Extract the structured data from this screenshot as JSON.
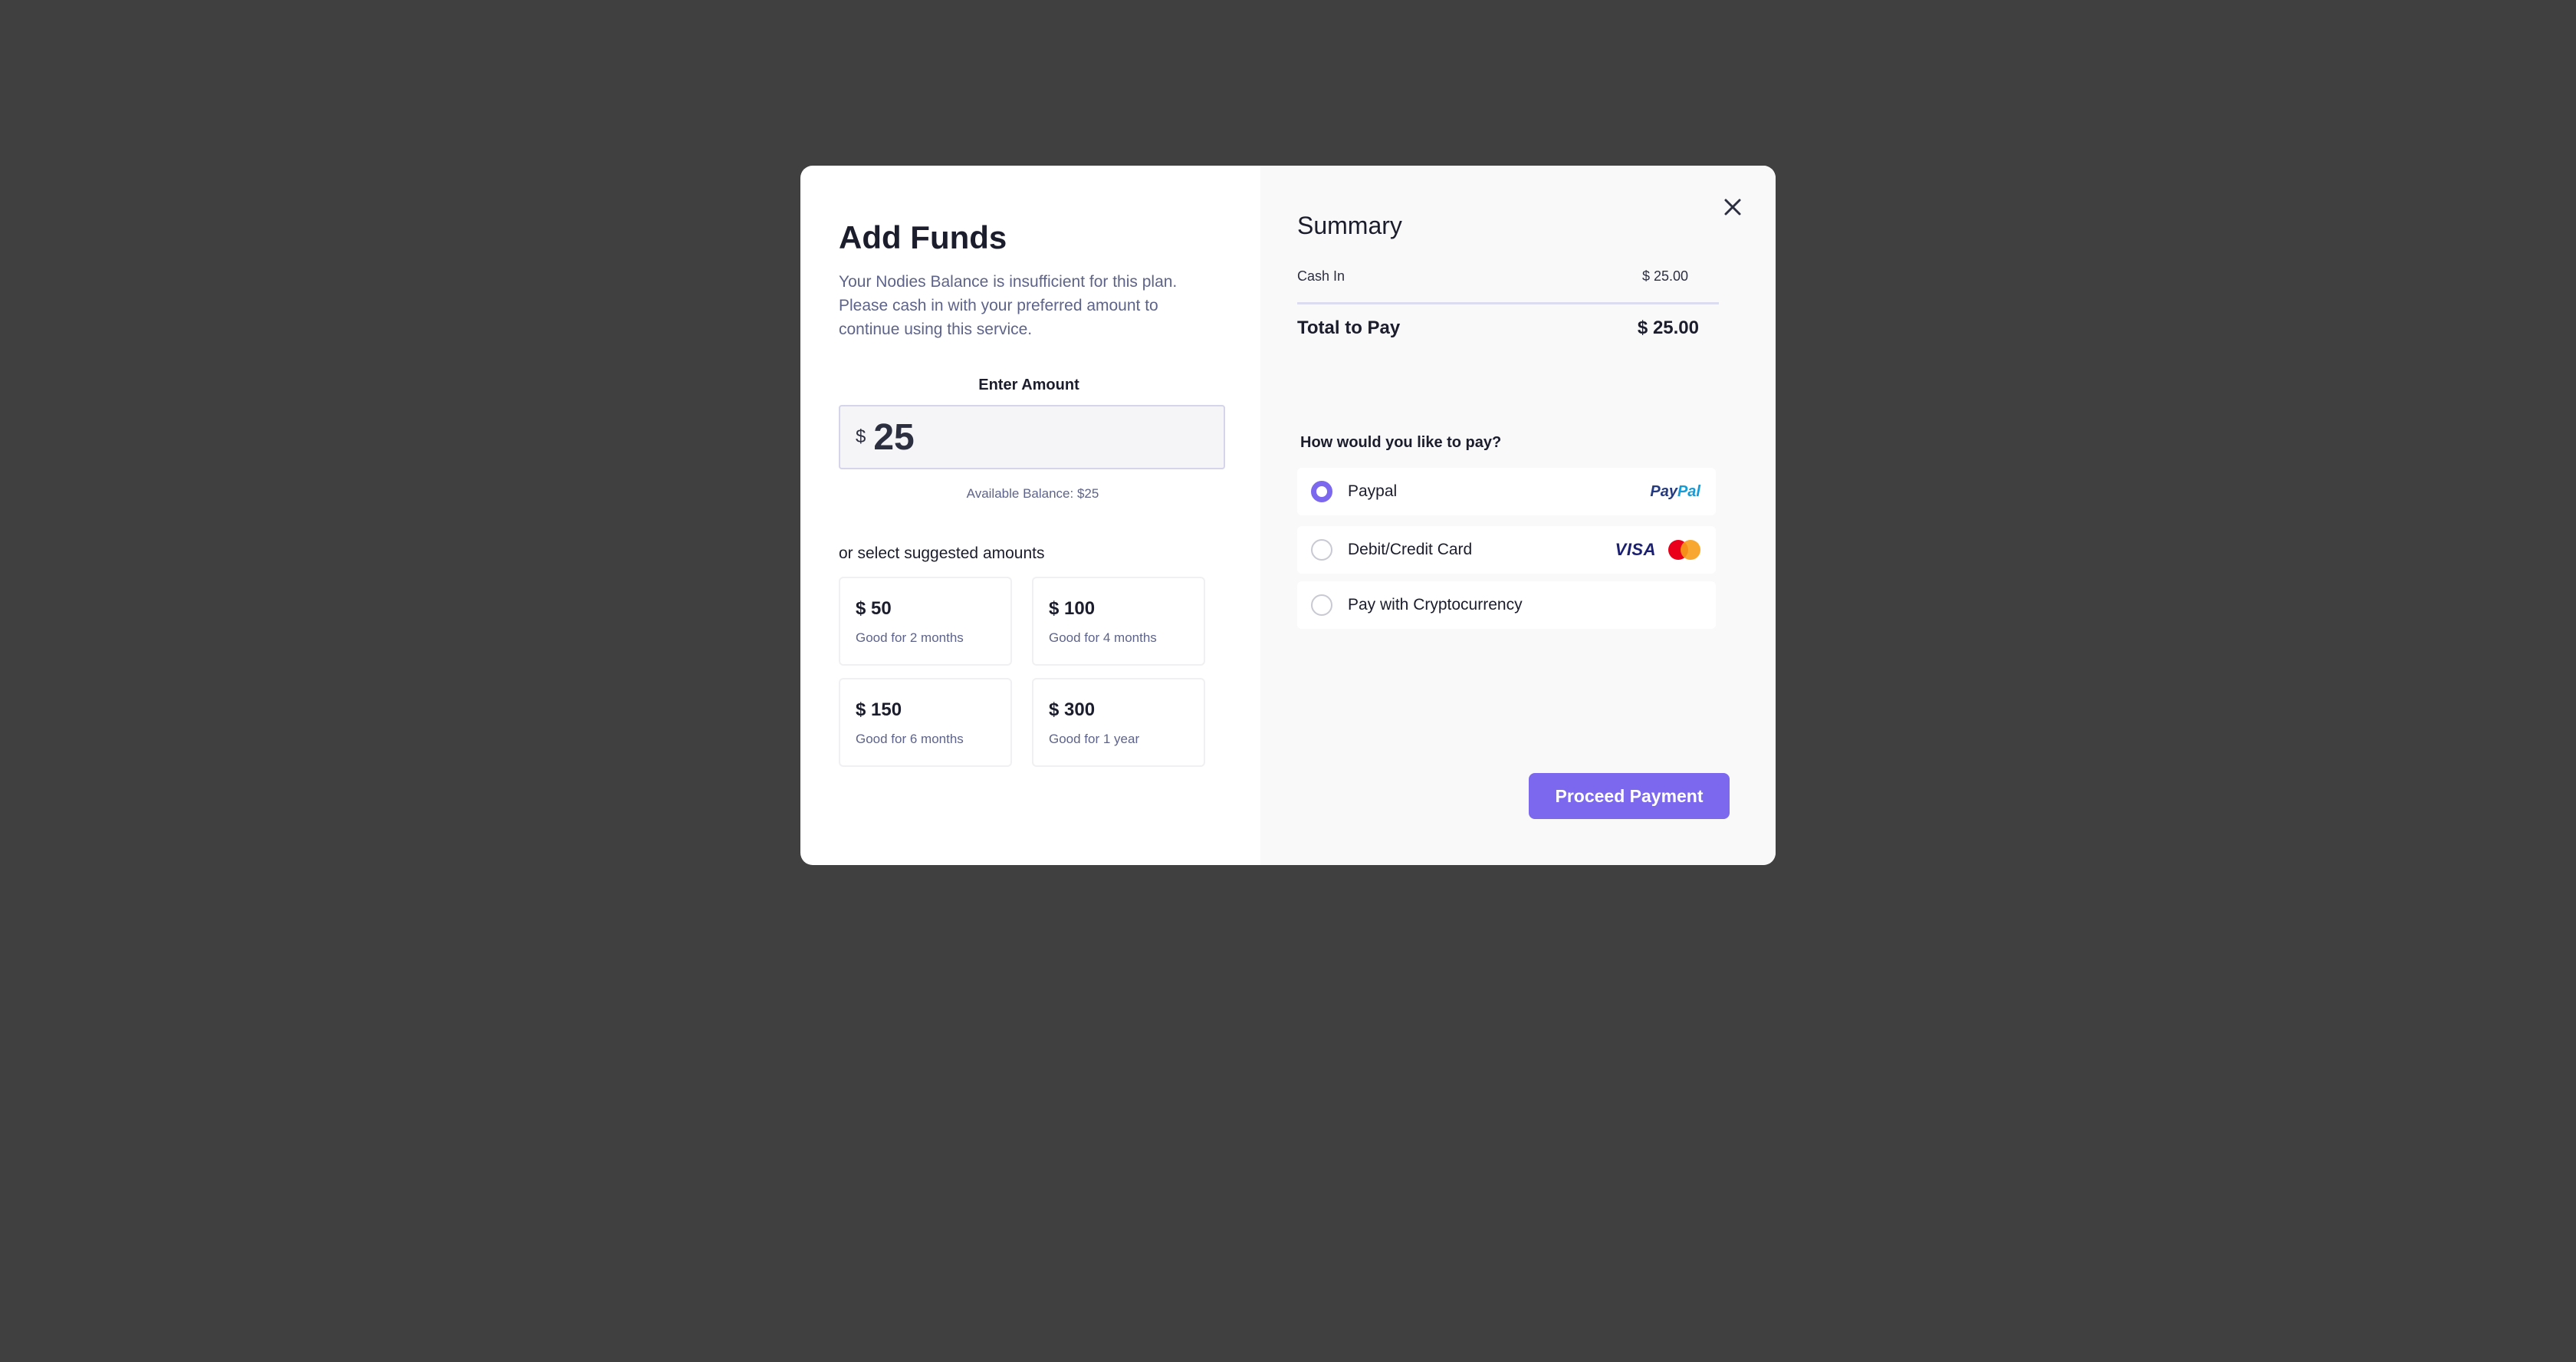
{
  "left": {
    "title": "Add Funds",
    "description": "Your Nodies Balance is insufficient for this plan. Please cash in with your preferred amount to continue using this service.",
    "enter_amount_label": "Enter Amount",
    "currency_symbol": "$",
    "amount_value": "25",
    "available_balance": "Available Balance: $25",
    "suggest_label": "or select suggested amounts",
    "suggestions": [
      {
        "amount": "$ 50",
        "note": "Good for 2 months"
      },
      {
        "amount": "$ 100",
        "note": "Good for 4 months"
      },
      {
        "amount": "$ 150",
        "note": "Good for 6 months"
      },
      {
        "amount": "$ 300",
        "note": "Good for 1 year"
      }
    ]
  },
  "right": {
    "close_icon": "close-icon",
    "summary_title": "Summary",
    "cash_in_label": "Cash In",
    "cash_in_value": "$ 25.00",
    "total_label": "Total to Pay",
    "total_value": "$ 25.00",
    "pay_question": "How would you like to pay?",
    "payment_options": [
      {
        "label": "Paypal",
        "selected": true,
        "logos": [
          "paypal-logo"
        ]
      },
      {
        "label": "Debit/Credit Card",
        "selected": false,
        "logos": [
          "visa-logo",
          "mastercard-logo"
        ]
      },
      {
        "label": "Pay with Cryptocurrency",
        "selected": false,
        "logos": []
      }
    ],
    "paypal_logo_text": {
      "pay": "Pay",
      "pal": "Pal"
    },
    "visa_logo_text": "VISA",
    "proceed_label": "Proceed Payment"
  },
  "colors": {
    "backdrop": "#404040",
    "accent": "#7b68ee",
    "text_primary": "#1b1d2c",
    "text_muted": "#5e6489"
  }
}
